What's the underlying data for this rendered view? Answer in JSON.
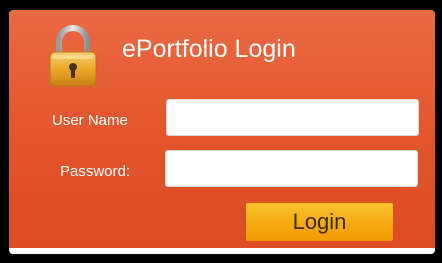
{
  "header": {
    "title": "ePortfolio Login",
    "icon": "padlock-icon"
  },
  "form": {
    "username": {
      "label": "User Name",
      "value": "",
      "placeholder": ""
    },
    "password": {
      "label": "Password:",
      "value": "",
      "placeholder": ""
    },
    "login_button_label": "Login"
  },
  "colors": {
    "panel_background": "#e2542c",
    "button_background": "#f6aa12",
    "text": "#ffffff",
    "frame": "#000000"
  }
}
